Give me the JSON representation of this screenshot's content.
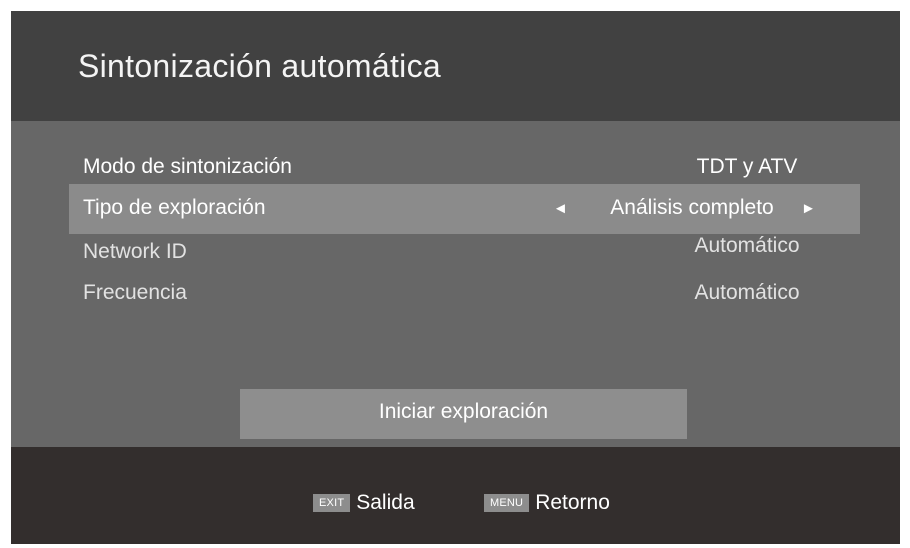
{
  "header": {
    "title": "Sintonización automática"
  },
  "settings": [
    {
      "label": "Modo de sintonización",
      "value": "TDT y ATV"
    },
    {
      "label": "Tipo de exploración",
      "value": "Análisis completo"
    },
    {
      "label": "Network ID",
      "value": "Automático"
    },
    {
      "label": "Frecuencia",
      "value": "Automático"
    }
  ],
  "start_button": {
    "label": "Iniciar exploración"
  },
  "footer": {
    "exit": {
      "key": "EXIT",
      "label": "Salida"
    },
    "menu": {
      "key": "MENU",
      "label": "Retorno"
    }
  },
  "icons": {
    "left": "triangle-left-icon",
    "right": "triangle-right-icon"
  },
  "colors": {
    "header_bg": "#414141",
    "body_bg": "#676767",
    "selected_bg": "#8b8b8b",
    "button_bg": "#8e8e8e",
    "footer_bg": "#332e2d"
  }
}
